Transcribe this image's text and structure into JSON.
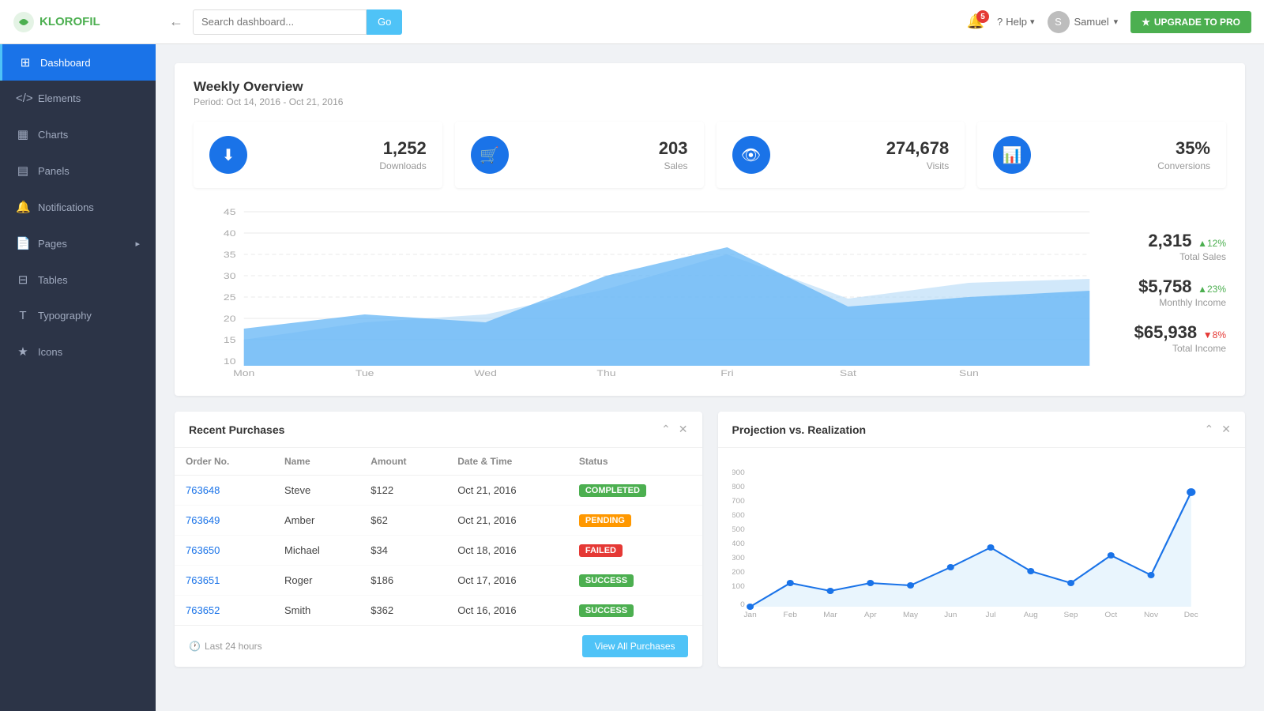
{
  "header": {
    "logo_text": "KLOROFIL",
    "search_placeholder": "Search dashboard...",
    "search_btn": "Go",
    "notif_count": "5",
    "help_label": "Help",
    "user_name": "Samuel",
    "upgrade_btn": "UPGRADE TO PRO"
  },
  "sidebar": {
    "items": [
      {
        "id": "dashboard",
        "label": "Dashboard",
        "icon": "⊞",
        "active": true
      },
      {
        "id": "elements",
        "label": "Elements",
        "icon": "</>"
      },
      {
        "id": "charts",
        "label": "Charts",
        "icon": "▦"
      },
      {
        "id": "panels",
        "label": "Panels",
        "icon": "▤"
      },
      {
        "id": "notifications",
        "label": "Notifications",
        "icon": "🔔"
      },
      {
        "id": "pages",
        "label": "Pages",
        "icon": "📄",
        "has_arrow": true
      },
      {
        "id": "tables",
        "label": "Tables",
        "icon": "⊟"
      },
      {
        "id": "typography",
        "label": "Typography",
        "icon": "T"
      },
      {
        "id": "icons",
        "label": "Icons",
        "icon": "★"
      }
    ]
  },
  "weekly_overview": {
    "title": "Weekly Overview",
    "period": "Period: Oct 14, 2016 - Oct 21, 2016",
    "stats": [
      {
        "id": "downloads",
        "value": "1,252",
        "label": "Downloads",
        "icon": "⬇"
      },
      {
        "id": "sales",
        "value": "203",
        "label": "Sales",
        "icon": "🛒"
      },
      {
        "id": "visits",
        "value": "274,678",
        "label": "Visits",
        "icon": "👁"
      },
      {
        "id": "conversions",
        "value": "35%",
        "label": "Conversions",
        "icon": "📊"
      }
    ],
    "chart": {
      "y_labels": [
        "45",
        "40",
        "35",
        "30",
        "25",
        "20",
        "15",
        "10"
      ],
      "x_labels": [
        "Mon",
        "Tue",
        "Wed",
        "Thu",
        "Fri",
        "Sat",
        "Sun"
      ]
    },
    "chart_stats": [
      {
        "id": "total-sales",
        "value": "2,315",
        "change": "+12%",
        "direction": "up",
        "label": "Total Sales"
      },
      {
        "id": "monthly-income",
        "value": "$5,758",
        "change": "+23%",
        "direction": "up",
        "label": "Monthly Income"
      },
      {
        "id": "total-income",
        "value": "$65,938",
        "change": "-8%",
        "direction": "down",
        "label": "Total Income"
      }
    ]
  },
  "recent_purchases": {
    "title": "Recent Purchases",
    "columns": [
      "Order No.",
      "Name",
      "Amount",
      "Date & Time",
      "Status"
    ],
    "rows": [
      {
        "order": "763648",
        "name": "Steve",
        "amount": "$122",
        "date": "Oct 21, 2016",
        "status": "COMPLETED",
        "status_type": "completed"
      },
      {
        "order": "763649",
        "name": "Amber",
        "amount": "$62",
        "date": "Oct 21, 2016",
        "status": "PENDING",
        "status_type": "pending"
      },
      {
        "order": "763650",
        "name": "Michael",
        "amount": "$34",
        "date": "Oct 18, 2016",
        "status": "FAILED",
        "status_type": "failed"
      },
      {
        "order": "763651",
        "name": "Roger",
        "amount": "$186",
        "date": "Oct 17, 2016",
        "status": "SUCCESS",
        "status_type": "success"
      },
      {
        "order": "763652",
        "name": "Smith",
        "amount": "$362",
        "date": "Oct 16, 2016",
        "status": "SUCCESS",
        "status_type": "success"
      }
    ],
    "footer_info": "Last 24 hours",
    "view_all_btn": "View All Purchases"
  },
  "projection": {
    "title": "Projection vs. Realization",
    "y_labels": [
      "900",
      "800",
      "700",
      "600",
      "500",
      "400",
      "300",
      "200",
      "100",
      "0"
    ],
    "x_labels": [
      "Jan",
      "Feb",
      "Mar",
      "Apr",
      "May",
      "Jun",
      "Jul",
      "Aug",
      "Sep",
      "Oct",
      "Nov",
      "Dec"
    ]
  },
  "colors": {
    "primary": "#1a73e8",
    "accent": "#4fc3f7",
    "success": "#4CAF50",
    "warning": "#FF9800",
    "danger": "#e53935",
    "sidebar_bg": "#2c3447",
    "chart_blue": "#64b5f6",
    "chart_light": "#b3d9f7"
  }
}
